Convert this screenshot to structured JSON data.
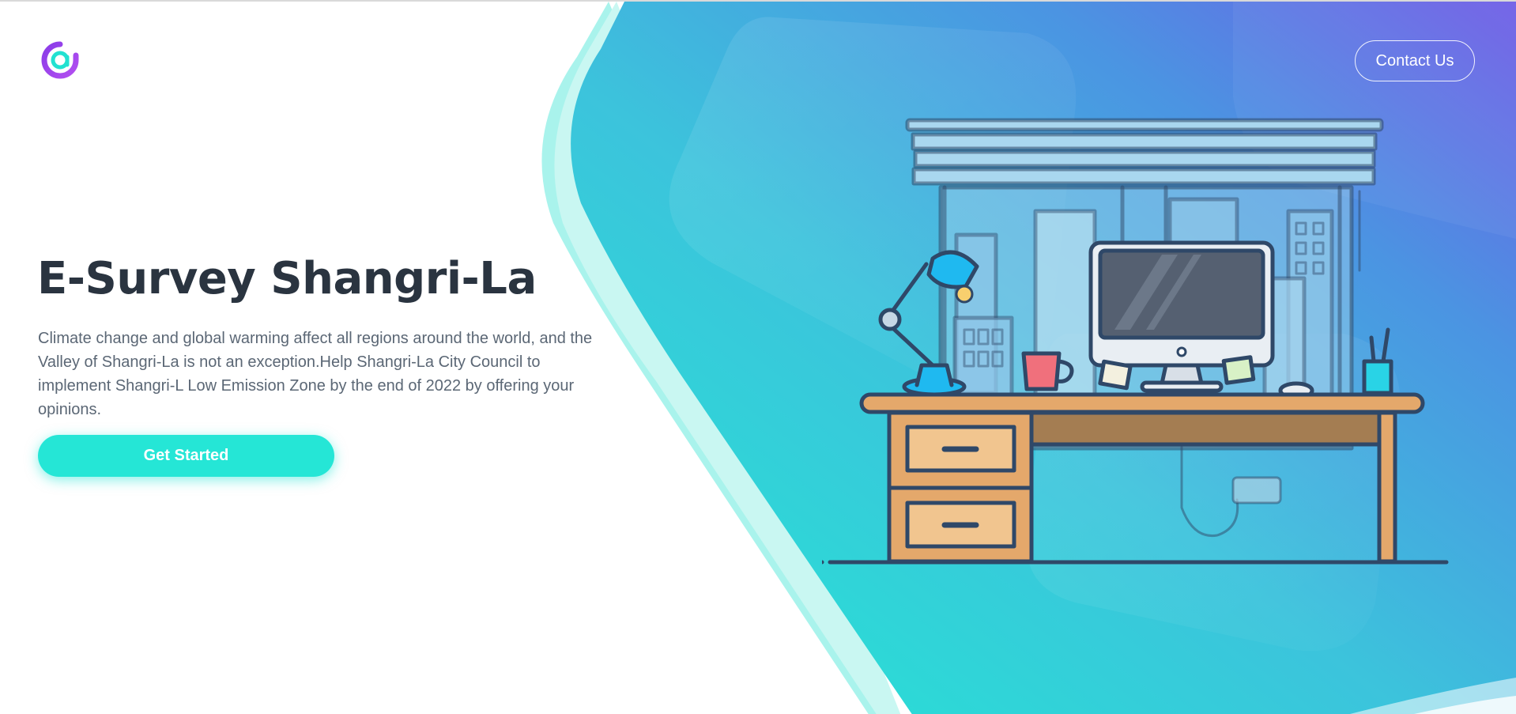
{
  "header": {
    "logo_icon": "at-sign-logo-icon",
    "contact_label": "Contact Us"
  },
  "hero": {
    "title": "E-Survey Shangri-La",
    "description": "Climate change and global warming affect all regions around the world, and the Valley of Shangri-La is not an exception.Help Shangri-La City Council to implement Shangri-L Low Emission Zone by the end of 2022 by offering your opinions.",
    "cta_label": "Get Started",
    "illustration": "desk-workspace-illustration"
  },
  "colors": {
    "accent": "#25e6d6",
    "gradient_start": "#22e8d3",
    "gradient_end": "#6f5de6",
    "title": "#2a3440",
    "text": "#5b6775"
  }
}
